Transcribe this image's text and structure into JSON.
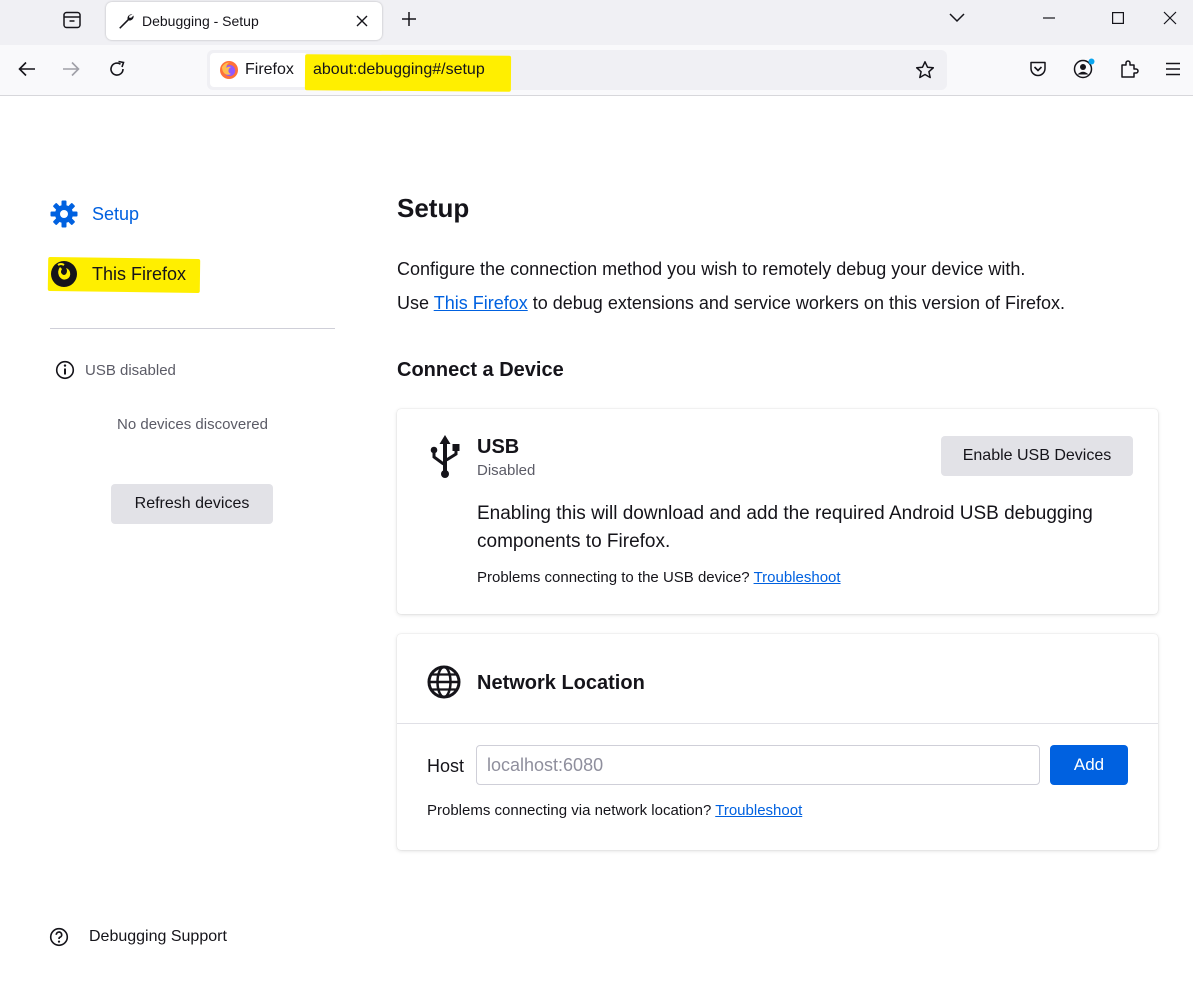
{
  "browser": {
    "tab": {
      "title": "Debugging - Setup",
      "icon": "wrench-icon"
    },
    "identity_label": "Firefox",
    "url": "about:debugging#/setup",
    "highlight_color": "#ffef00"
  },
  "sidebar": {
    "setup_label": "Setup",
    "this_firefox_label": "This Firefox",
    "usb_status": "USB disabled",
    "no_devices": "No devices discovered",
    "refresh_label": "Refresh devices",
    "support_label": "Debugging Support"
  },
  "main": {
    "title": "Setup",
    "intro_line1": "Configure the connection method you wish to remotely debug your device with.",
    "intro_use": "Use",
    "intro_link": "This Firefox",
    "intro_rest": "to debug extensions and service workers on this version of Firefox.",
    "connect_title": "Connect a Device"
  },
  "usb_card": {
    "title": "USB",
    "status": "Disabled",
    "enable_label": "Enable USB Devices",
    "description": "Enabling this will download and add the required Android USB debugging components to Firefox.",
    "help_text": "Problems connecting to the USB device?",
    "help_link": "Troubleshoot"
  },
  "network_card": {
    "title": "Network Location",
    "host_label": "Host",
    "host_placeholder": "localhost:6080",
    "add_label": "Add",
    "help_text": "Problems connecting via network location?",
    "help_link": "Troubleshoot"
  },
  "colors": {
    "accent": "#0061e0",
    "text": "#15141a",
    "muted": "#5b5b66"
  }
}
